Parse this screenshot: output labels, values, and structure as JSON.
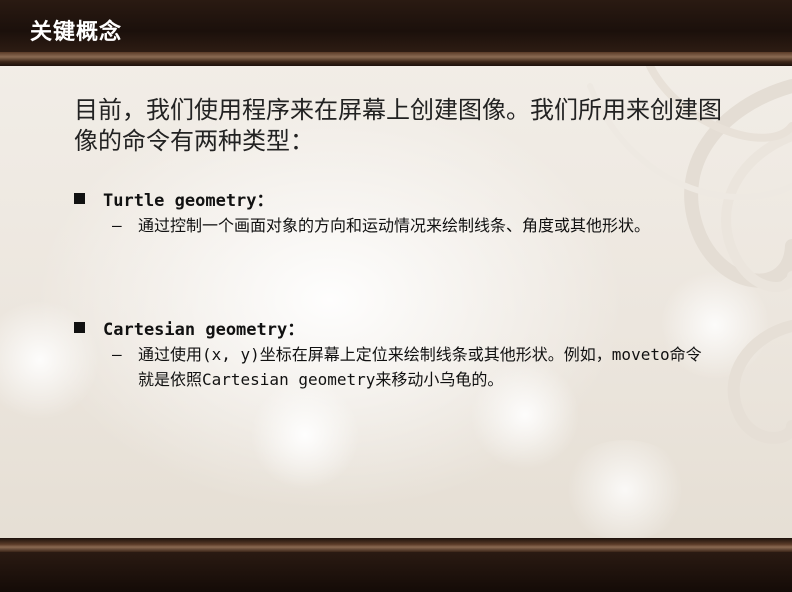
{
  "slide": {
    "title": "关键概念",
    "intro": "目前，我们使用程序来在屏幕上创建图像。我们所用来创建图像的命令有两种类型：",
    "sections": [
      {
        "heading": "Turtle geometry：",
        "dash": "–",
        "detail": "通过控制一个画面对象的方向和运动情况来绘制线条、角度或其他形状。"
      },
      {
        "heading": "Cartesian geometry：",
        "dash": "–",
        "detail": "通过使用(x, y)坐标在屏幕上定位来绘制线条或其他形状。例如，moveto命令就是依照Cartesian geometry来移动小乌龟的。"
      }
    ]
  },
  "colors": {
    "frame_dark": "#1b100b",
    "frame_accent": "#8a6a52",
    "background": "#f2ede6",
    "text": "#222222",
    "title_text": "#ffffff"
  }
}
